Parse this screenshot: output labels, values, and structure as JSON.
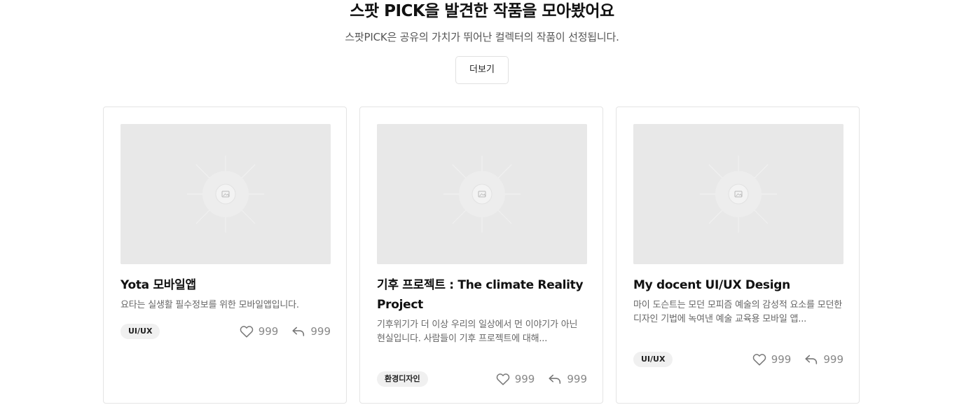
{
  "section": {
    "title": "스팟 PICK을 발견한 작품을 모아봤어요",
    "subtitle": "스팟PICK은 공유의 가치가 뛰어난 컬렉터의 작품이 선정됩니다.",
    "more_label": "더보기"
  },
  "cards": [
    {
      "title": "Yota 모바일앱",
      "description": "요타는 실생활 필수정보를 위한 모바일앱입니다.",
      "tag": "UI/UX",
      "likes": "999",
      "shares": "999",
      "thumbnail_icon": "image-placeholder-icon"
    },
    {
      "title": "기후 프로젝트 : The climate Reality Project",
      "description": "기후위기가 더 이상 우리의 일상에서 먼 이야기가 아닌 현실입니다. 사람들이 기후 프로젝트에 대해...",
      "tag": "환경디자인",
      "likes": "999",
      "shares": "999",
      "thumbnail_icon": "image-placeholder-icon"
    },
    {
      "title": "My docent UI/UX Design",
      "description": "마이 도슨트는 모던 모피즘 예술의 감성적 요소를 모던한 디자인 기법에 녹여낸 예술 교육용 모바일 앱...",
      "tag": "UI/UX",
      "likes": "999",
      "shares": "999",
      "thumbnail_icon": "image-placeholder-icon"
    }
  ],
  "icons": {
    "like": "heart-icon",
    "share": "reply-arrow-icon"
  },
  "colors": {
    "thumbnail_bg": "#e8e8e8",
    "tag_bg": "#f0f0f0",
    "border": "#e4e4e4",
    "muted_text": "#888888"
  }
}
